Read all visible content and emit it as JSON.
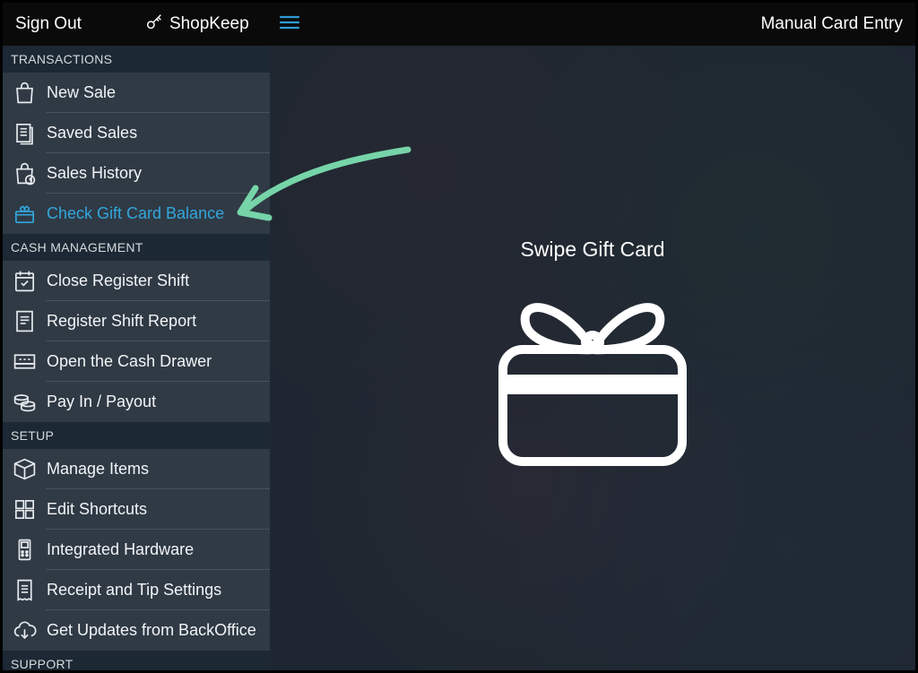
{
  "header": {
    "signout": "Sign Out",
    "brand": "ShopKeep",
    "manual_entry": "Manual Card Entry"
  },
  "sidebar": {
    "sections": {
      "transactions": {
        "title": "TRANSACTIONS",
        "items": [
          "New Sale",
          "Saved Sales",
          "Sales History",
          "Check Gift Card Balance"
        ]
      },
      "cash": {
        "title": "CASH MANAGEMENT",
        "items": [
          "Close Register Shift",
          "Register Shift Report",
          "Open the Cash Drawer",
          "Pay In / Payout"
        ]
      },
      "setup": {
        "title": "SETUP",
        "items": [
          "Manage Items",
          "Edit Shortcuts",
          "Integrated Hardware",
          "Receipt and Tip Settings",
          "Get Updates from BackOffice"
        ]
      },
      "support": {
        "title": "SUPPORT"
      }
    },
    "active_item": "Check Gift Card Balance"
  },
  "main": {
    "title": "Swipe Gift Card"
  },
  "colors": {
    "accent": "#32a6dc",
    "sidebar_bg": "#2f3a45",
    "section_bg": "#1c2833",
    "annotation": "#76d4a8"
  }
}
